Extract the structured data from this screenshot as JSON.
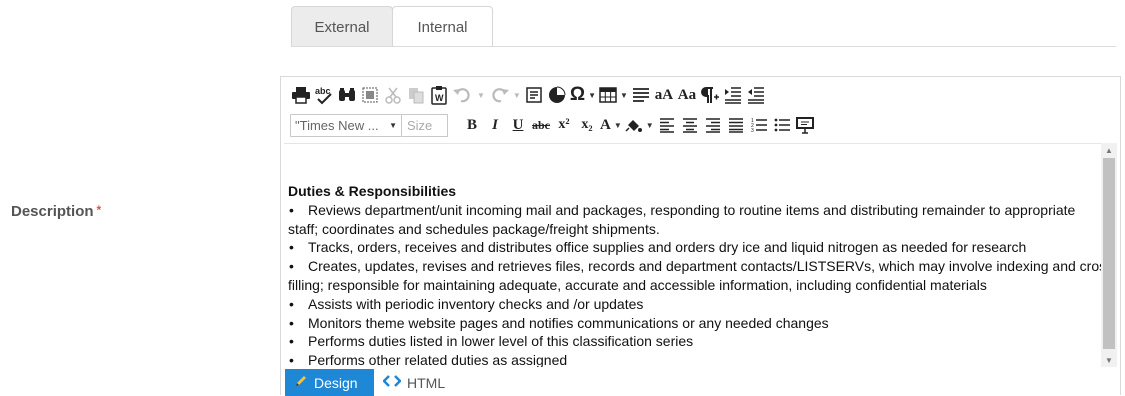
{
  "tabs": [
    {
      "label": "External",
      "active": true
    },
    {
      "label": "Internal",
      "active": false
    }
  ],
  "field": {
    "label": "Description",
    "required_mark": "*"
  },
  "toolbar": {
    "row1_icons": [
      "print-icon",
      "spellcheck-icon",
      "find-icon",
      "select-all-icon",
      "cut-icon",
      "copy-icon",
      "paste-word-icon",
      "undo-icon",
      "redo-icon",
      "insert-form-icon",
      "insert-media-icon",
      "omega-symbol-icon",
      "table-icon",
      "paragraph-align-icon",
      "font-size-increase-icon",
      "font-case-icon",
      "paragraph-mark-icon",
      "indent-icon",
      "outdent-icon"
    ],
    "font_name": "\"Times New ...",
    "font_size_placeholder": "Size",
    "bold_label": "B",
    "italic_label": "I",
    "underline_label": "U",
    "strike_label": "abc",
    "superscript_label": "x²",
    "subscript_label": "x₂",
    "font_color_label": "A",
    "case_small": "aA",
    "case_title": "Aa",
    "omega": "Ω",
    "accent_color": "#1e88d6"
  },
  "content": {
    "heading": "Duties & Responsibilities",
    "bullets": [
      {
        "line1": "Reviews department/unit incoming mail and packages, responding to routine items and distributing remainder to appropriate",
        "line2": "staff; coordinates and schedules package/freight shipments."
      },
      {
        "line1": "Tracks, orders, receives and distributes office supplies and orders dry ice and liquid nitrogen as needed for research",
        "line2": ""
      },
      {
        "line1": "Creates, updates, revises and retrieves files, records and department contacts/LISTSERVs, which may involve indexing and cross",
        "line2": "filling; responsible for maintaining adequate, accurate and accessible information, including confidential materials"
      },
      {
        "line1": "Assists with periodic inventory checks and /or updates",
        "line2": ""
      },
      {
        "line1": "Monitors theme website pages and notifies communications or any needed changes",
        "line2": ""
      },
      {
        "line1": "Performs duties listed in lower level of this classification series",
        "line2": ""
      },
      {
        "line1": "Performs other related duties as assigned",
        "line2": ""
      }
    ]
  },
  "modes": {
    "design_label": "Design",
    "html_label": "HTML"
  }
}
